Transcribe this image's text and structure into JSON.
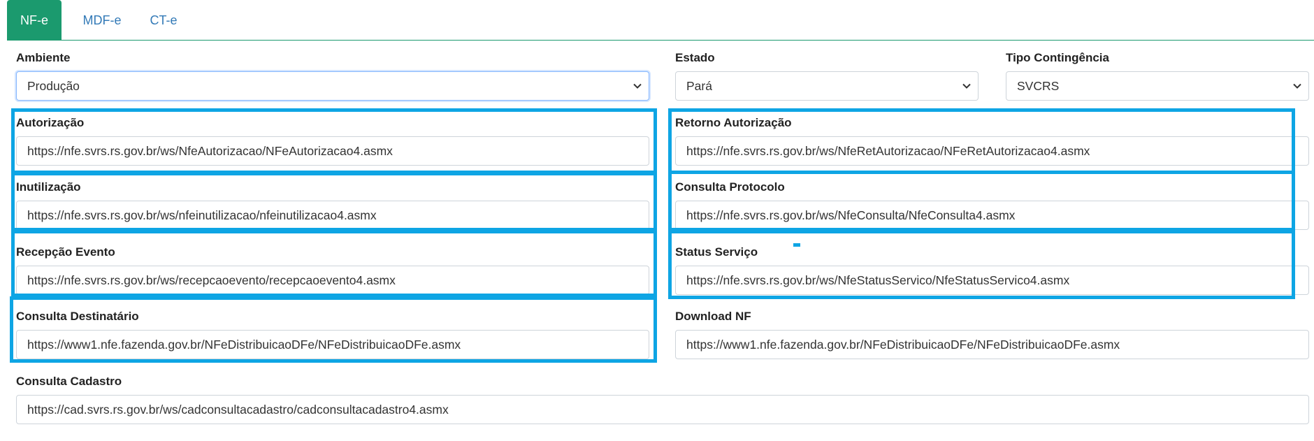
{
  "tabs": [
    {
      "label": "NF-e",
      "active": true
    },
    {
      "label": "MDF-e",
      "active": false
    },
    {
      "label": "CT-e",
      "active": false
    }
  ],
  "ambiente": {
    "label": "Ambiente",
    "value": "Produção"
  },
  "estado": {
    "label": "Estado",
    "value": "Pará"
  },
  "tipo_contingencia": {
    "label": "Tipo Contingência",
    "value": "SVCRS"
  },
  "fields": {
    "autorizacao": {
      "label": "Autorização",
      "value": "https://nfe.svrs.rs.gov.br/ws/NfeAutorizacao/NFeAutorizacao4.asmx"
    },
    "retorno_autorizacao": {
      "label": "Retorno Autorização",
      "value": "https://nfe.svrs.rs.gov.br/ws/NfeRetAutorizacao/NFeRetAutorizacao4.asmx"
    },
    "inutilizacao": {
      "label": "Inutilização",
      "value": "https://nfe.svrs.rs.gov.br/ws/nfeinutilizacao/nfeinutilizacao4.asmx"
    },
    "consulta_protocolo": {
      "label": "Consulta Protocolo",
      "value": "https://nfe.svrs.rs.gov.br/ws/NfeConsulta/NfeConsulta4.asmx"
    },
    "recepcao_evento": {
      "label": "Recepção Evento",
      "value": "https://nfe.svrs.rs.gov.br/ws/recepcaoevento/recepcaoevento4.asmx"
    },
    "status_servico": {
      "label": "Status Serviço",
      "value": "https://nfe.svrs.rs.gov.br/ws/NfeStatusServico/NfeStatusServico4.asmx"
    },
    "consulta_destinatario": {
      "label": "Consulta Destinatário",
      "value": "https://www1.nfe.fazenda.gov.br/NFeDistribuicaoDFe/NFeDistribuicaoDFe.asmx"
    },
    "download_nf": {
      "label": "Download NF",
      "value": "https://www1.nfe.fazenda.gov.br/NFeDistribuicaoDFe/NFeDistribuicaoDFe.asmx"
    },
    "consulta_cadastro": {
      "label": "Consulta Cadastro",
      "value": "https://cad.svrs.rs.gov.br/ws/cadconsultacadastro/cadconsultacadastro4.asmx"
    }
  },
  "colors": {
    "tab_active": "#1b9a6e",
    "highlight": "#0ea5e4",
    "link": "#337ab7"
  }
}
